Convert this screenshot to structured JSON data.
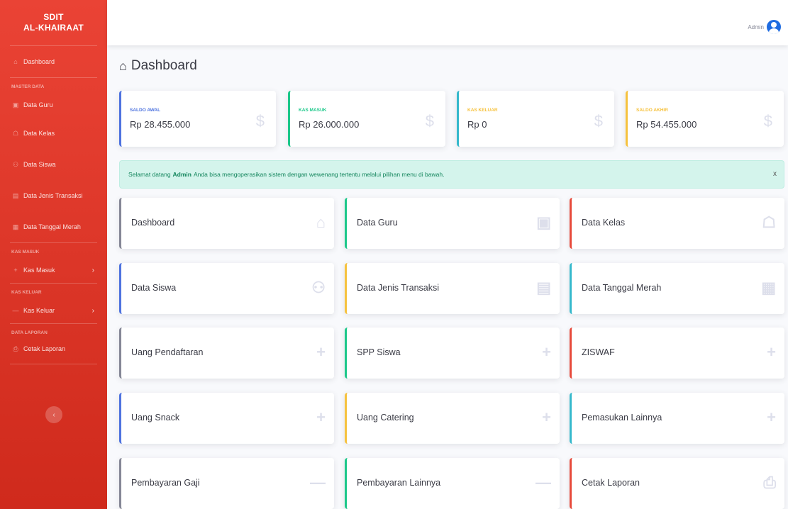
{
  "sidebar": {
    "brand_line1": "SDIT",
    "brand_line2": "AL-KHAIRAAT",
    "dashboard": "Dashboard",
    "heading_master": "MASTER DATA",
    "data_guru": "Data Guru",
    "data_kelas": "Data Kelas",
    "data_siswa": "Data Siswa",
    "data_jenis_transaksi": "Data Jenis Transaksi",
    "data_tanggal_merah": "Data Tanggal Merah",
    "heading_kas_masuk": "KAS MASUK",
    "kas_masuk": "Kas Masuk",
    "heading_kas_keluar": "KAS KELUAR",
    "kas_keluar": "Kas Keluar",
    "heading_laporan": "DATA LAPORAN",
    "cetak_laporan": "Cetak Laporan"
  },
  "topbar": {
    "user_name": "Admin"
  },
  "page": {
    "title": "Dashboard"
  },
  "stats": [
    {
      "label": "SALDO AWAL",
      "value": "Rp 28.455.000",
      "color": "#4e73df"
    },
    {
      "label": "KAS MASUK",
      "value": "Rp 26.000.000",
      "color": "#1cc88a"
    },
    {
      "label": "KAS KELUAR",
      "value": "Rp 0",
      "color": "#f6c23e"
    },
    {
      "label": "SALDO AKHIR",
      "value": "Rp 54.455.000",
      "color": "#f6c23e"
    }
  ],
  "alert": {
    "prefix": "Selamat datang",
    "user": "Admin",
    "suffix": "Anda bisa mengoperasikan sistem dengan wewenang tertentu melalui pilihan menu di bawah.",
    "close": "x"
  },
  "cards": [
    {
      "title": "Dashboard",
      "icon": "home-icon"
    },
    {
      "title": "Data Guru",
      "icon": "teacher-icon"
    },
    {
      "title": "Data Kelas",
      "icon": "building-icon"
    },
    {
      "title": "Data Siswa",
      "icon": "users-icon"
    },
    {
      "title": "Data Jenis Transaksi",
      "icon": "money-icon"
    },
    {
      "title": "Data Tanggal Merah",
      "icon": "calendar-icon"
    },
    {
      "title": "Uang Pendaftaran",
      "icon": "plus-icon"
    },
    {
      "title": "SPP Siswa",
      "icon": "plus-icon"
    },
    {
      "title": "ZISWAF",
      "icon": "plus-icon"
    },
    {
      "title": "Uang Snack",
      "icon": "plus-icon"
    },
    {
      "title": "Uang Catering",
      "icon": "plus-icon"
    },
    {
      "title": "Pemasukan Lainnya",
      "icon": "plus-icon"
    },
    {
      "title": "Pembayaran Gaji",
      "icon": "minus-icon"
    },
    {
      "title": "Pembayaran Lainnya",
      "icon": "minus-icon"
    },
    {
      "title": "Cetak Laporan",
      "icon": "print-icon"
    }
  ],
  "colors": {
    "sidebar": "#e74a3b",
    "primary": "#4e73df",
    "success": "#1cc88a",
    "warning": "#f6c23e",
    "info": "#36b9cc",
    "danger": "#e74a3b",
    "secondary": "#858796"
  }
}
